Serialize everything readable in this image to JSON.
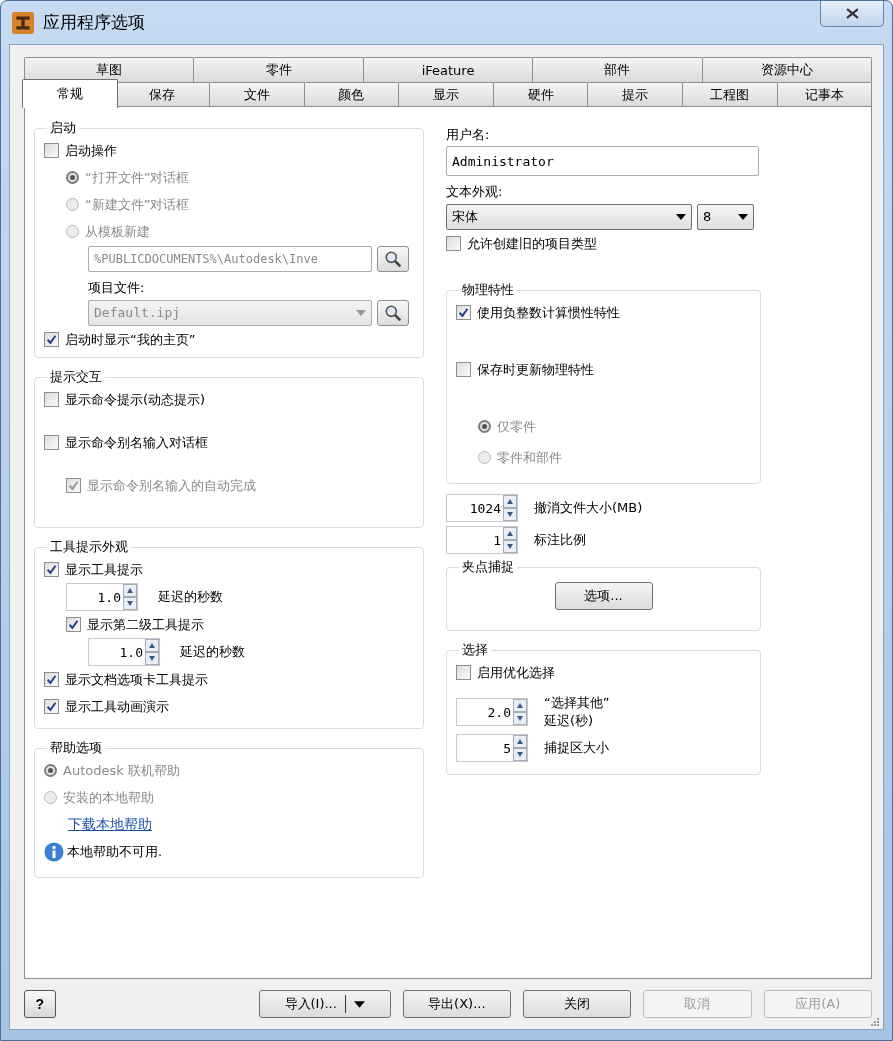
{
  "window": {
    "title": "应用程序选项"
  },
  "tab_rows": [
    {
      "tabs": [
        {
          "label": "草图",
          "selected": false
        },
        {
          "label": "零件",
          "selected": false
        },
        {
          "label": "iFeature",
          "selected": false
        },
        {
          "label": "部件",
          "selected": false
        },
        {
          "label": "资源中心",
          "selected": false
        }
      ]
    },
    {
      "tabs": [
        {
          "label": "常规",
          "selected": true
        },
        {
          "label": "保存",
          "selected": false
        },
        {
          "label": "文件",
          "selected": false
        },
        {
          "label": "颜色",
          "selected": false
        },
        {
          "label": "显示",
          "selected": false
        },
        {
          "label": "硬件",
          "selected": false
        },
        {
          "label": "提示",
          "selected": false
        },
        {
          "label": "工程图",
          "selected": false
        },
        {
          "label": "记事本",
          "selected": false
        }
      ]
    }
  ],
  "left_column": [
    {
      "kind": "group",
      "title": "启动",
      "items": [
        {
          "kind": "checkbox",
          "label": "启动操作",
          "checked": false,
          "disabled": false,
          "children": [
            {
              "kind": "radio",
              "label": "“打开文件”对话框",
              "selected": true,
              "disabled": true
            },
            {
              "kind": "radio",
              "label": "“新建文件”对话框",
              "selected": false,
              "disabled": true
            },
            {
              "kind": "radio",
              "label": "从模板新建",
              "selected": false,
              "disabled": true,
              "children": [
                {
                  "kind": "path_field",
                  "value": "%PUBLICDOCUMENTS%\\Autodesk\\Inve",
                  "disabled": true
                },
                {
                  "kind": "caption",
                  "label": "项目文件:"
                },
                {
                  "kind": "combo",
                  "value": "Default.ipj",
                  "disabled": true
                }
              ]
            }
          ]
        },
        {
          "kind": "checkbox",
          "label": "启动时显示“我的主页”",
          "checked": true,
          "disabled": false
        }
      ]
    },
    {
      "kind": "group",
      "title": "提示交互",
      "items": [
        {
          "kind": "checkbox",
          "label": "显示命令提示(动态提示)",
          "checked": false,
          "disabled": false
        },
        {
          "kind": "checkbox",
          "label": "显示命令别名输入对话框",
          "checked": false,
          "disabled": false,
          "children": [
            {
              "kind": "checkbox",
              "label": "显示命令别名输入的自动完成",
              "checked": true,
              "disabled": true
            }
          ]
        }
      ]
    },
    {
      "kind": "group",
      "title": "工具提示外观",
      "items": [
        {
          "kind": "checkbox",
          "label": "显示工具提示",
          "checked": true,
          "disabled": false,
          "children": [
            {
              "kind": "spinner",
              "value": "1.0",
              "label": "延迟的秒数"
            },
            {
              "kind": "checkbox",
              "label": "显示第二级工具提示",
              "checked": true,
              "disabled": false,
              "children": [
                {
                  "kind": "spinner",
                  "value": "1.0",
                  "label": "延迟的秒数"
                }
              ]
            }
          ]
        },
        {
          "kind": "checkbox",
          "label": "显示文档选项卡工具提示",
          "checked": true,
          "disabled": false
        },
        {
          "kind": "checkbox",
          "label": "显示工具动画演示",
          "checked": true,
          "disabled": false
        }
      ]
    },
    {
      "kind": "group",
      "title": "帮助选项",
      "items": [
        {
          "kind": "radio",
          "label": "Autodesk 联机帮助",
          "selected": true,
          "disabled": true
        },
        {
          "kind": "radio",
          "label": "安装的本地帮助",
          "selected": false,
          "disabled": true
        },
        {
          "kind": "link",
          "label": "下载本地帮助"
        },
        {
          "kind": "info",
          "label": "本地帮助不可用."
        }
      ]
    }
  ],
  "right_column": [
    {
      "kind": "caption",
      "label": "用户名:"
    },
    {
      "kind": "text_field",
      "value": "Administrator"
    },
    {
      "kind": "caption",
      "label": "文本外观:"
    },
    {
      "kind": "font_row",
      "font": "宋体",
      "size": "8"
    },
    {
      "kind": "checkbox",
      "label": "允许创建旧的项目类型",
      "checked": false,
      "disabled": false
    },
    {
      "kind": "group",
      "title": "物理特性",
      "items": [
        {
          "kind": "checkbox",
          "label": "使用负整数计算惯性特性",
          "checked": true,
          "disabled": false
        },
        {
          "kind": "checkbox",
          "label": "保存时更新物理特性",
          "checked": false,
          "disabled": false,
          "children": [
            {
              "kind": "radio",
              "label": "仅零件",
              "selected": true,
              "disabled": true
            },
            {
              "kind": "radio",
              "label": "零件和部件",
              "selected": false,
              "disabled": true
            }
          ]
        }
      ]
    },
    {
      "kind": "spinner",
      "value": "1024",
      "label": "撤消文件大小(MB)"
    },
    {
      "kind": "spinner",
      "value": "1",
      "label": "标注比例"
    },
    {
      "kind": "group",
      "title": "夹点捕捉",
      "items": [
        {
          "kind": "button",
          "label": "选项..."
        }
      ]
    },
    {
      "kind": "group",
      "title": "选择",
      "items": [
        {
          "kind": "checkbox",
          "label": "启用优化选择",
          "checked": false,
          "disabled": false
        },
        {
          "kind": "spinner",
          "value": "2.0",
          "label": "“选择其他”\n延迟(秒)"
        },
        {
          "kind": "spinner",
          "value": "5",
          "label": "捕捉区大小"
        }
      ]
    }
  ],
  "help_button": {
    "label": "?"
  },
  "buttons": [
    {
      "kind": "split",
      "label": "导入(I)...",
      "disabled": false
    },
    {
      "kind": "plain",
      "label": "导出(X)...",
      "disabled": false
    },
    {
      "kind": "plain",
      "label": "关闭",
      "disabled": false
    },
    {
      "kind": "plain",
      "label": "取消",
      "disabled": true
    },
    {
      "kind": "plain",
      "label": "应用(A)",
      "disabled": true
    }
  ]
}
